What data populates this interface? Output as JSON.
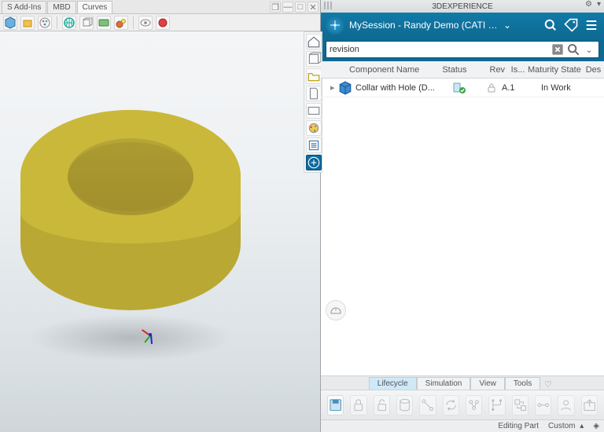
{
  "cad": {
    "tabs": [
      "S Add-Ins",
      "MBD",
      "Curves"
    ],
    "active_tab_index": 2
  },
  "vstrip": {
    "items": [
      "home-icon",
      "model-icon",
      "folder-icon",
      "document-icon",
      "view-icon",
      "globe-icon",
      "properties-icon",
      "session-icon"
    ],
    "active_index": 7
  },
  "dx": {
    "titlebar": "3DEXPERIENCE",
    "session": "MySession - Randy Demo (CATI DEMO ...",
    "search_value": "revision",
    "columns": {
      "name": "Component Name",
      "status": "Status",
      "rev": "Rev",
      "is": "Is...",
      "maturity": "Maturity State",
      "des": "Des"
    },
    "row": {
      "name": "Collar with Hole (D...",
      "rev": "A.1",
      "maturity": "In Work"
    },
    "bottom_tabs": [
      "Lifecycle",
      "Simulation",
      "View",
      "Tools"
    ],
    "bottom_tab_active": 0,
    "statusbar": {
      "mode": "Editing Part",
      "profile": "Custom"
    }
  }
}
